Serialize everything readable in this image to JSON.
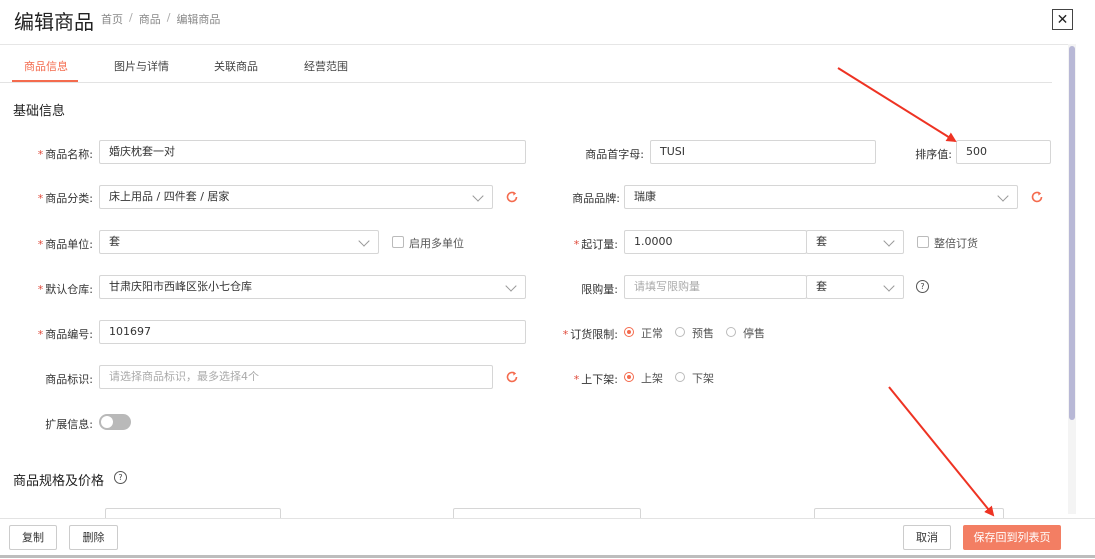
{
  "header": {
    "title": "编辑商品",
    "breadcrumb": [
      "首页",
      "商品",
      "编辑商品"
    ],
    "breadcrumb_sep": "/"
  },
  "tabs": [
    "商品信息",
    "图片与详情",
    "关联商品",
    "经营范围"
  ],
  "basic_section": {
    "title": "基础信息"
  },
  "form": {
    "name": {
      "label": "商品名称:",
      "value": "婚庆枕套一对"
    },
    "initials": {
      "label": "商品首字母:",
      "value": "TUSI"
    },
    "sort": {
      "label": "排序值:",
      "value": "500"
    },
    "category": {
      "label": "商品分类:",
      "value": "床上用品 / 四件套 / 居家"
    },
    "brand": {
      "label": "商品品牌:",
      "value": "瑞康"
    },
    "unit": {
      "label": "商品单位:",
      "value": "套",
      "multi_unit_label": "启用多单位"
    },
    "moq": {
      "label": "起订量:",
      "value": "1.0000",
      "unit": "套",
      "whole_label": "整倍订货"
    },
    "warehouse": {
      "label": "默认仓库:",
      "value": "甘肃庆阳市西峰区张小七仓库"
    },
    "limit": {
      "label": "限购量:",
      "placeholder": "请填写限购量",
      "unit": "套"
    },
    "code": {
      "label": "商品编号:",
      "value": "101697"
    },
    "order_limit": {
      "label": "订货限制:",
      "options": [
        "正常",
        "预售",
        "停售"
      ],
      "selected": "正常"
    },
    "tags": {
      "label": "商品标识:",
      "placeholder": "请选择商品标识，最多选择4个"
    },
    "shelf": {
      "label": "上下架:",
      "options": [
        "上架",
        "下架"
      ],
      "selected": "上架"
    },
    "ext": {
      "label": "扩展信息:",
      "enabled": false
    }
  },
  "spec_section": {
    "title": "商品规格及价格"
  },
  "footer": {
    "copy": "复制",
    "delete": "删除",
    "cancel": "取消",
    "save": "保存回到列表页"
  },
  "colors": {
    "accent": "#f46b4e",
    "annotation_arrow": "#ee3323"
  },
  "icons": [
    "close-icon",
    "refresh-icon",
    "chevron-down-icon",
    "help-icon"
  ]
}
